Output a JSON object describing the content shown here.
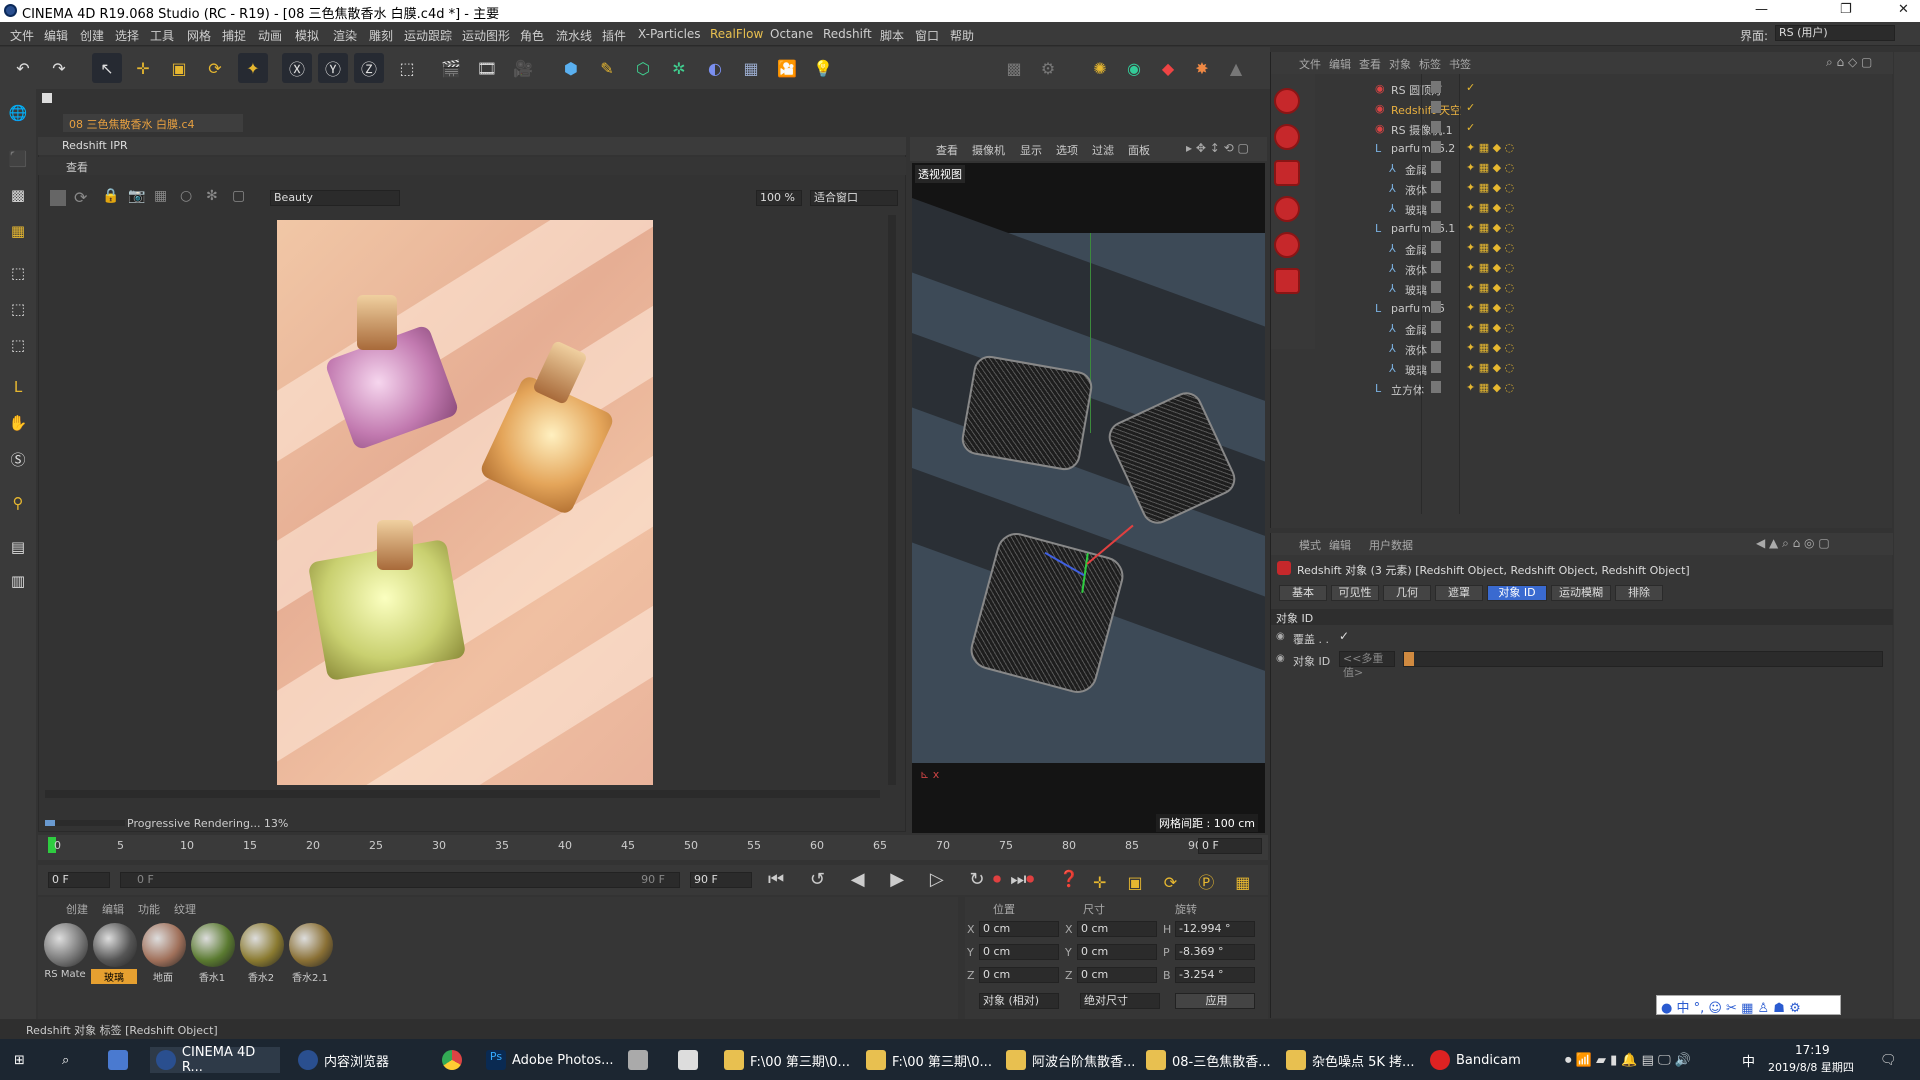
{
  "window": {
    "title": "CINEMA 4D R19.068 Studio (RC - R19) - [08 三色焦散香水 白膜.c4d *] - 主要"
  },
  "menu": [
    "文件",
    "编辑",
    "创建",
    "选择",
    "工具",
    "网格",
    "捕捉",
    "动画",
    "模拟",
    "渲染",
    "雕刻",
    "运动跟踪",
    "运动图形",
    "角色",
    "流水线",
    "插件",
    "X-Particles",
    "RealFlow",
    "Octane",
    "Redshift",
    "脚本",
    "窗口",
    "帮助"
  ],
  "layout": {
    "label": "界面:",
    "value": "RS (用户)"
  },
  "doc_tab": "08 三色焦散香水 白膜.c4",
  "ipr": {
    "title": "Redshift IPR",
    "view_menu": "查看",
    "aov": "Beauty",
    "zoom": "100 %",
    "fit": "适合窗口",
    "progress_text": "Progressive Rendering... 13%",
    "progress": 0.13
  },
  "viewport": {
    "menu": [
      "查看",
      "摄像机",
      "显示",
      "选项",
      "过滤",
      "面板"
    ],
    "label": "透视视图",
    "grid": "网格间距 : 100 cm"
  },
  "objmgr": {
    "menu": [
      "文件",
      "编辑",
      "查看",
      "对象",
      "标签",
      "书签"
    ],
    "objects": [
      {
        "name": "RS 圆顶灯",
        "indent": 0,
        "color": "#c8c8c8"
      },
      {
        "name": "Redshift 天空",
        "indent": 0,
        "color": "#e8b040"
      },
      {
        "name": "RS 摄像机.1",
        "indent": 0,
        "color": "#c8c8c8"
      },
      {
        "name": "parfum16.2",
        "indent": 0,
        "color": "#c8c8c8"
      },
      {
        "name": "金属",
        "indent": 1,
        "color": "#c8c8c8"
      },
      {
        "name": "液体",
        "indent": 1,
        "color": "#c8c8c8"
      },
      {
        "name": "玻璃",
        "indent": 1,
        "color": "#c8c8c8"
      },
      {
        "name": "parfum16.1",
        "indent": 0,
        "color": "#c8c8c8"
      },
      {
        "name": "金属",
        "indent": 1,
        "color": "#c8c8c8"
      },
      {
        "name": "液体",
        "indent": 1,
        "color": "#c8c8c8"
      },
      {
        "name": "玻璃",
        "indent": 1,
        "color": "#c8c8c8"
      },
      {
        "name": "parfum16",
        "indent": 0,
        "color": "#c8c8c8"
      },
      {
        "name": "金属",
        "indent": 1,
        "color": "#c8c8c8"
      },
      {
        "name": "液体",
        "indent": 1,
        "color": "#c8c8c8"
      },
      {
        "name": "玻璃",
        "indent": 1,
        "color": "#c8c8c8"
      },
      {
        "name": "立方体",
        "indent": 0,
        "color": "#c8c8c8"
      }
    ]
  },
  "attr": {
    "menu": [
      "模式",
      "编辑",
      "用户数据"
    ],
    "title": "Redshift 对象 (3 元素) [Redshift Object, Redshift Object, Redshift Object]",
    "tabs": [
      "基本",
      "可见性",
      "几何",
      "遮罩",
      "对象 ID",
      "运动模糊",
      "排除"
    ],
    "active_tab": "对象 ID",
    "section": "对象 ID",
    "override_label": "覆盖 . .",
    "override_check": "✓",
    "objid_label": "对象 ID",
    "objid_value": "<<多重值>"
  },
  "timeline": {
    "ticks": [
      "0",
      "5",
      "10",
      "15",
      "20",
      "25",
      "30",
      "35",
      "40",
      "45",
      "50",
      "55",
      "60",
      "65",
      "70",
      "75",
      "80",
      "85",
      "90"
    ],
    "end": "0 F"
  },
  "transport": {
    "start": "0 F",
    "range_start": "0 F",
    "range_end": "90 F",
    "end": "90 F"
  },
  "materials": {
    "menu": [
      "创建",
      "编辑",
      "功能",
      "纹理"
    ],
    "items": [
      {
        "label": "RS Mate",
        "color": "#777"
      },
      {
        "label": "玻璃",
        "color": "#555"
      },
      {
        "label": "地面",
        "color": "#a0705a"
      },
      {
        "label": "香水1",
        "color": "#5a7a30"
      },
      {
        "label": "香水2",
        "color": "#8a7a30"
      },
      {
        "label": "香水2.1",
        "color": "#8a7035"
      }
    ]
  },
  "coords": {
    "headers": [
      "位置",
      "尺寸",
      "旋转"
    ],
    "rows": [
      [
        "X",
        "0 cm",
        "X",
        "0 cm",
        "H",
        "-12.994 °"
      ],
      [
        "Y",
        "0 cm",
        "Y",
        "0 cm",
        "P",
        "-8.369 °"
      ],
      [
        "Z",
        "0 cm",
        "Z",
        "0 cm",
        "B",
        "-3.254 °"
      ]
    ],
    "mode1": "对象 (相对)",
    "mode2": "绝对尺寸",
    "apply": "应用"
  },
  "status": "Redshift 对象 标签 [Redshift Object]",
  "taskbar": {
    "items": [
      "CINEMA 4D R...",
      "内容浏览器",
      "Adobe Photos...",
      "F:\\00 第三期\\0...",
      "F:\\00 第三期\\0...",
      "阿波台阶焦散香...",
      "08-三色焦散香...",
      "杂色噪点 5K 拷...",
      "Bandicam"
    ],
    "time": "17:19",
    "date": "2019/8/8 星期四",
    "ime": "中"
  }
}
